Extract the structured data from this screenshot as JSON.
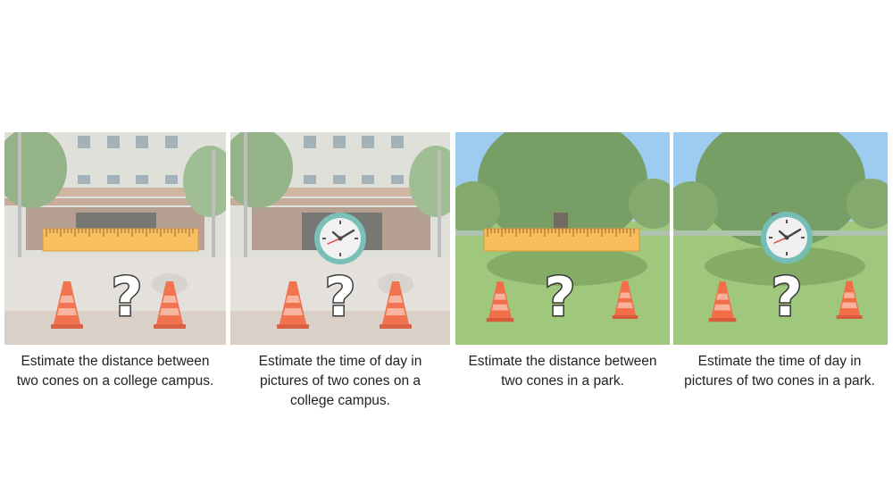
{
  "panels": [
    {
      "caption": "Estimate the distance between\ntwo cones on a college campus."
    },
    {
      "caption": "Estimate the time of day in\npictures of two cones on a\ncollege campus."
    },
    {
      "caption": "Estimate the distance between\ntwo cones in a park."
    },
    {
      "caption": "Estimate the time of day in\npictures of two cones in a park."
    }
  ],
  "colors": {
    "ruler": "#f7b13f",
    "cone": "#f0552a",
    "clock_rim": "#5fb3a8",
    "grass": "#8fbf66",
    "sky": "#8ec3ee"
  },
  "icons": [
    "ruler-icon",
    "clock-icon",
    "question-mark-icon",
    "traffic-cone-icon"
  ]
}
